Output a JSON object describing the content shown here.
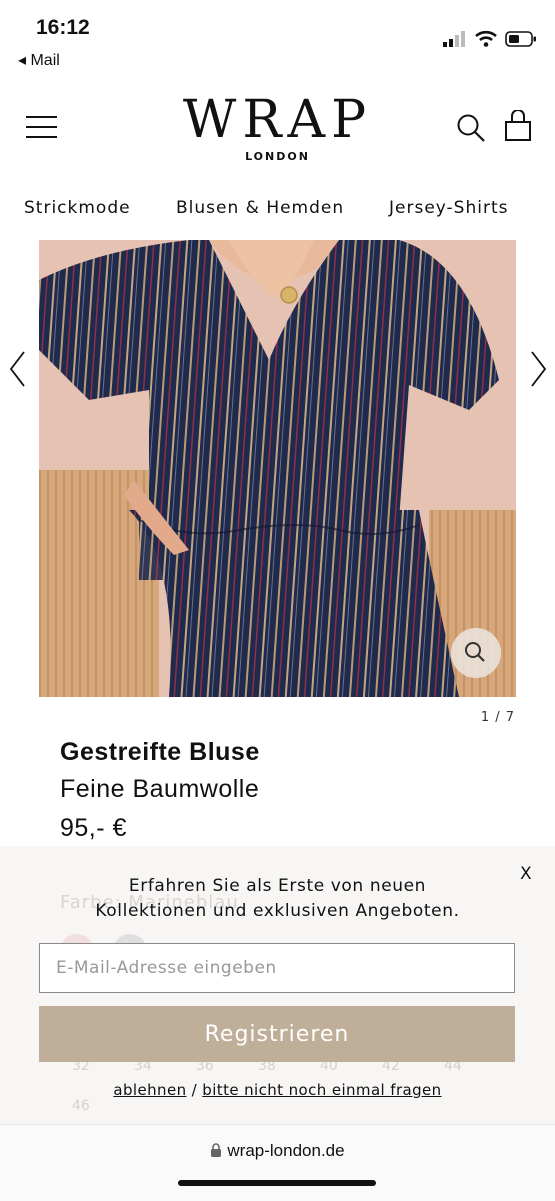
{
  "status_bar": {
    "time": "16:12",
    "back_label": "◂ Mail"
  },
  "header": {
    "logo_main": "WRAP",
    "logo_sub": "LONDON"
  },
  "categories": [
    "Strickmode",
    "Blusen & Hemden",
    "Jersey-Shirts"
  ],
  "gallery": {
    "counter": "1 / 7"
  },
  "product": {
    "title": "Gestreifte Bluse",
    "subtitle": "Feine Baumwolle",
    "price": "95,- €"
  },
  "background_ghost": {
    "color_label": "Farbe: Marineblau",
    "sizes": [
      "32",
      "34",
      "36",
      "38",
      "40",
      "42",
      "44",
      "46"
    ]
  },
  "popup": {
    "close_label": "X",
    "message_line1": "Erfahren Sie als Erste von neuen",
    "message_line2": "Kollektionen und exklusiven Angeboten.",
    "email_placeholder": "E-Mail-Adresse eingeben",
    "register_label": "Registrieren",
    "decline_label": "ablehnen",
    "separator": "/",
    "never_ask_label": "bitte nicht noch einmal fragen"
  },
  "browser": {
    "url": "wrap-london.de"
  },
  "colors": {
    "register_button": "#bfae98",
    "stripe_navy": "#1f2a4d",
    "background_pink": "#e9c6b5"
  }
}
